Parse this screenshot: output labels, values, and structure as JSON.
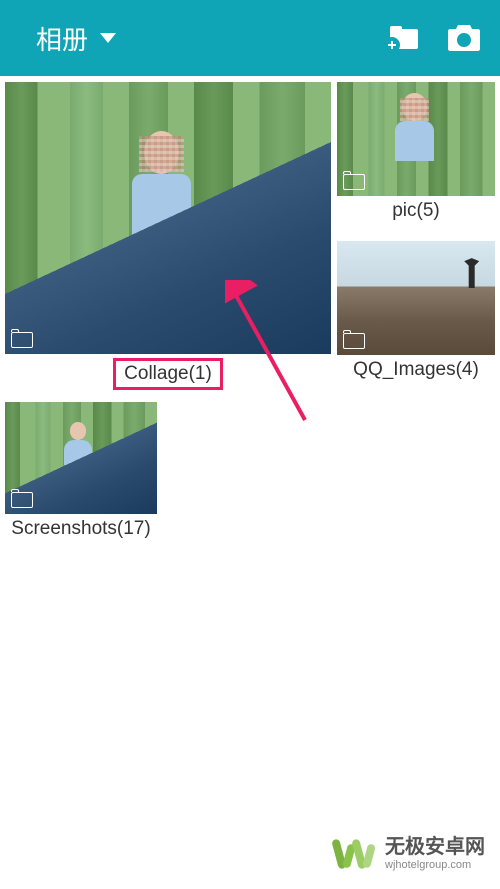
{
  "header": {
    "title": "相册"
  },
  "albums": [
    {
      "name": "Collage",
      "count": 1,
      "label": "Collage(1)",
      "highlighted": true
    },
    {
      "name": "pic",
      "count": 5,
      "label": "pic(5)",
      "highlighted": false
    },
    {
      "name": "QQ_Images",
      "count": 4,
      "label": "QQ_Images(4)",
      "highlighted": false
    },
    {
      "name": "Screenshots",
      "count": 17,
      "label": "Screenshots(17)",
      "highlighted": false
    }
  ],
  "watermark": {
    "title": "无极安卓网",
    "url": "wjhotelgroup.com"
  },
  "annotation": {
    "arrow_color": "#e91e63",
    "highlight_color": "#e91e63"
  }
}
